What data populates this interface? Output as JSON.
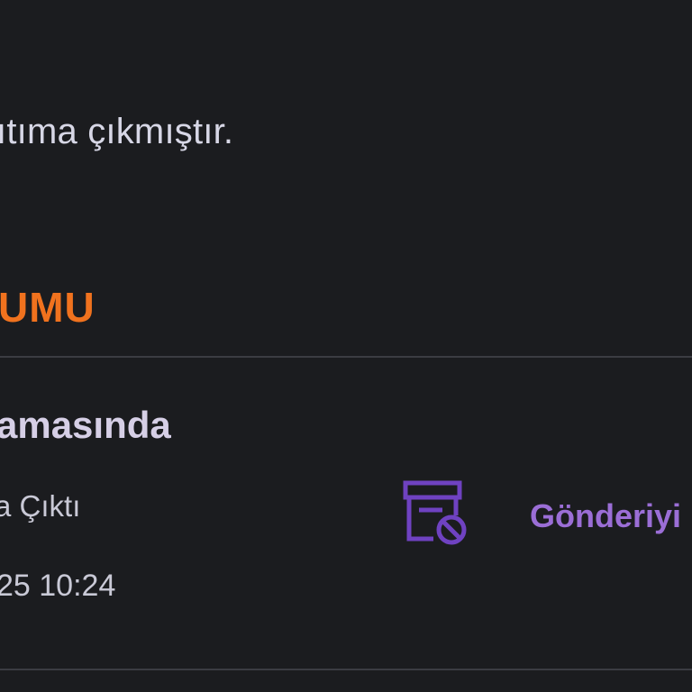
{
  "notice": {
    "text": "ıtıma çıkmıştır."
  },
  "section": {
    "title": "UMU"
  },
  "status": {
    "heading": "amasında",
    "subtitle": "a Çıktı",
    "time": "25 10:24"
  },
  "action": {
    "icon": "archive-cancel-icon",
    "label": "Gönderiyi İ"
  },
  "colors": {
    "background": "#1b1c1f",
    "accent_orange": "#f0721e",
    "accent_purple": "#9b6ed6",
    "icon_purple": "#6f42c1",
    "divider": "#3b3c42"
  }
}
